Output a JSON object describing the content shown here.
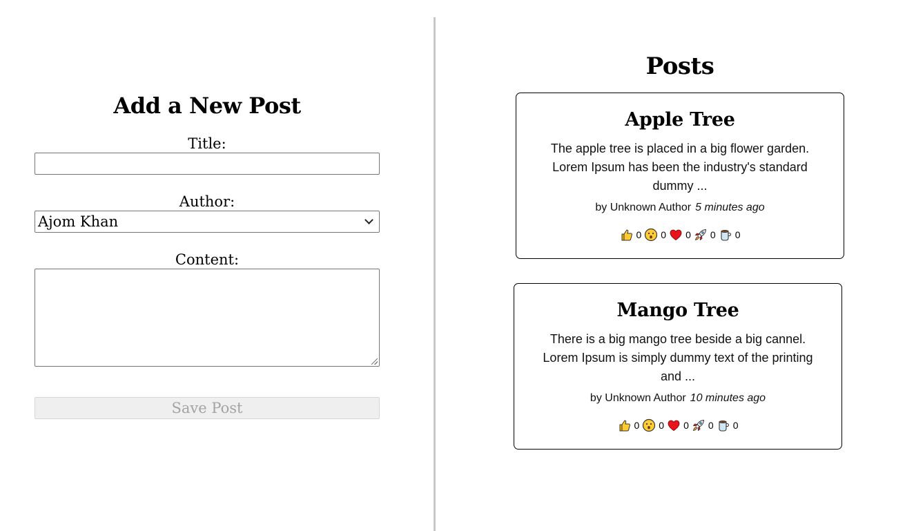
{
  "form": {
    "heading": "Add a New Post",
    "title_label": "Title:",
    "title_value": "",
    "author_label": "Author:",
    "author_selected": "Ajom Khan",
    "content_label": "Content:",
    "content_value": "",
    "save_label": "Save Post"
  },
  "posts_section": {
    "heading": "Posts",
    "posts": [
      {
        "title": "Apple Tree",
        "excerpt": "The apple tree is placed in a big flower garden. Lorem Ipsum has been the industry's standard dummy ...",
        "author": "by Unknown Author",
        "time": "5 minutes ago",
        "reactions": [
          {
            "icon": "thumbs-up-icon",
            "count": "0"
          },
          {
            "icon": "wow-face-icon",
            "count": "0"
          },
          {
            "icon": "heart-icon",
            "count": "0"
          },
          {
            "icon": "rocket-icon",
            "count": "0"
          },
          {
            "icon": "coffee-icon",
            "count": "0"
          }
        ]
      },
      {
        "title": "Mango Tree",
        "excerpt": "There is a big mango tree beside a big cannel. Lorem Ipsum is simply dummy text of the printing and ...",
        "author": "by Unknown Author",
        "time": "10 minutes ago",
        "reactions": [
          {
            "icon": "thumbs-up-icon",
            "count": "0"
          },
          {
            "icon": "wow-face-icon",
            "count": "0"
          },
          {
            "icon": "heart-icon",
            "count": "0"
          },
          {
            "icon": "rocket-icon",
            "count": "0"
          },
          {
            "icon": "coffee-icon",
            "count": "0"
          }
        ]
      }
    ]
  },
  "colors": {
    "divider": "#c8c8c8",
    "disabled_button_bg": "#efefef",
    "disabled_button_text": "#a3a3a3"
  }
}
